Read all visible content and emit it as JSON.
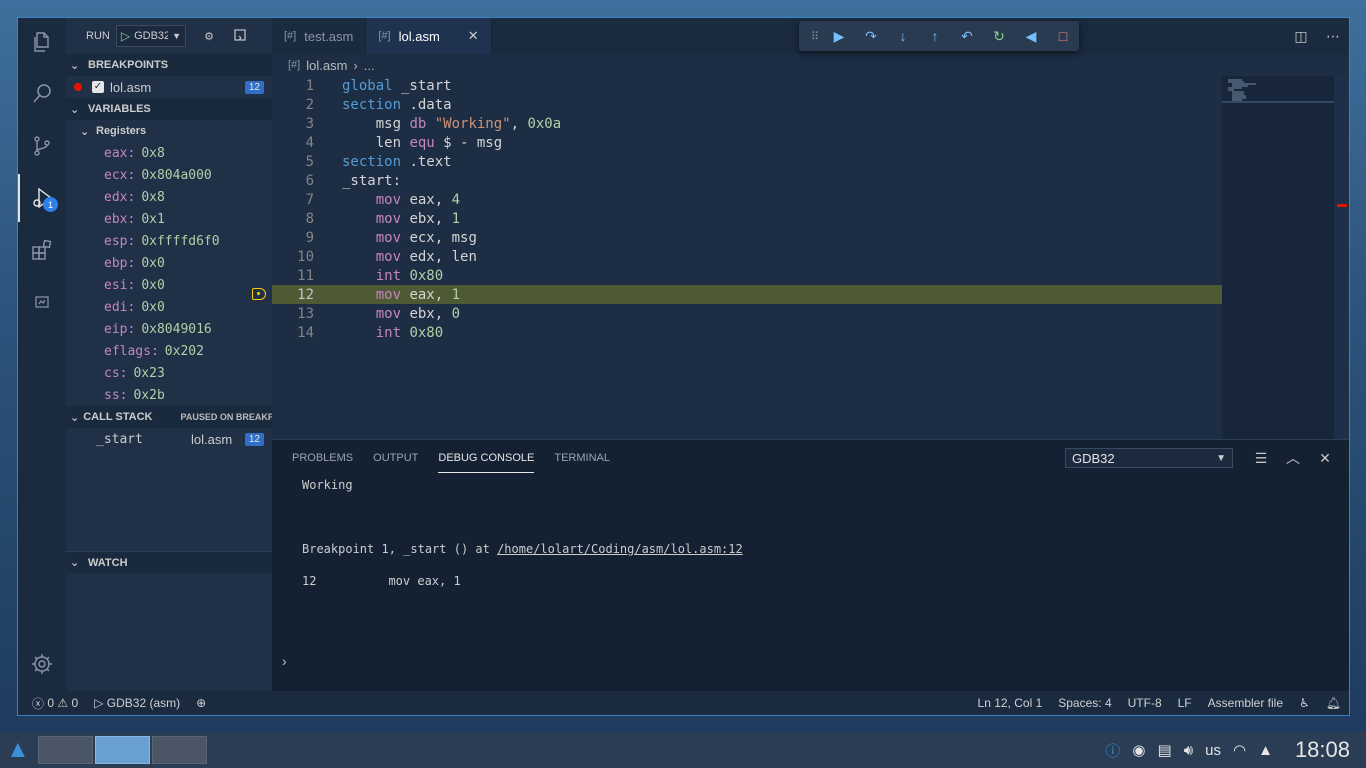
{
  "run_bar": {
    "label": "RUN",
    "config": "GDB32"
  },
  "breakpoints": {
    "title": "BREAKPOINTS",
    "items": [
      {
        "file": "lol.asm",
        "line": "12"
      }
    ]
  },
  "variables": {
    "title": "VARIABLES",
    "group": "Registers",
    "registers": [
      {
        "name": "eax:",
        "value": "0x8"
      },
      {
        "name": "ecx:",
        "value": "0x804a000"
      },
      {
        "name": "edx:",
        "value": "0x8"
      },
      {
        "name": "ebx:",
        "value": "0x1"
      },
      {
        "name": "esp:",
        "value": "0xffffd6f0"
      },
      {
        "name": "ebp:",
        "value": "0x0"
      },
      {
        "name": "esi:",
        "value": "0x0"
      },
      {
        "name": "edi:",
        "value": "0x0"
      },
      {
        "name": "eip:",
        "value": "0x8049016"
      },
      {
        "name": "eflags:",
        "value": "0x202"
      },
      {
        "name": "cs:",
        "value": "0x23"
      },
      {
        "name": "ss:",
        "value": "0x2b"
      }
    ]
  },
  "call_stack": {
    "title": "CALL STACK",
    "status": "PAUSED ON BREAKPOI",
    "frames": [
      {
        "name": "_start",
        "file": "lol.asm",
        "line": "12"
      }
    ]
  },
  "watch": {
    "title": "WATCH"
  },
  "tabs": [
    {
      "label": "test.asm",
      "active": false
    },
    {
      "label": "lol.asm",
      "active": true
    }
  ],
  "breadcrumb": {
    "file": "lol.asm",
    "rest": "..."
  },
  "code": {
    "lines": [
      {
        "n": "1"
      },
      {
        "n": "2"
      },
      {
        "n": "3"
      },
      {
        "n": "4"
      },
      {
        "n": "5"
      },
      {
        "n": "6"
      },
      {
        "n": "7"
      },
      {
        "n": "8"
      },
      {
        "n": "9"
      },
      {
        "n": "10"
      },
      {
        "n": "11"
      },
      {
        "n": "12"
      },
      {
        "n": "13"
      },
      {
        "n": "14"
      }
    ],
    "tokens": {
      "l1a": "global",
      "l1b": " _start",
      "l2a": "section",
      "l2b": " .data",
      "l3a": "    msg ",
      "l3b": "db",
      "l3c": " \"Working\"",
      "l3d": ", ",
      "l3e": "0x0a",
      "l4a": "    len ",
      "l4b": "equ",
      "l4c": " $ - msg",
      "l5a": "section",
      "l5b": " .text",
      "l6a": "_start:",
      "l7a": "    ",
      "l7b": "mov",
      "l7c": " eax, ",
      "l7d": "4",
      "l8a": "    ",
      "l8b": "mov",
      "l8c": " ebx, ",
      "l8d": "1",
      "l9a": "    ",
      "l9b": "mov",
      "l9c": " ecx, msg",
      "l10a": "    ",
      "l10b": "mov",
      "l10c": " edx, len",
      "l11a": "    ",
      "l11b": "int",
      "l11c": " ",
      "l11d": "0x80",
      "l12a": "    ",
      "l12b": "mov",
      "l12c": " eax, ",
      "l12d": "1",
      "l13a": "    ",
      "l13b": "mov",
      "l13c": " ebx, ",
      "l13d": "0",
      "l14a": "    ",
      "l14b": "int",
      "l14c": " ",
      "l14d": "0x80"
    }
  },
  "panel": {
    "tabs": [
      "PROBLEMS",
      "OUTPUT",
      "DEBUG CONSOLE",
      "TERMINAL"
    ],
    "active_tab": "DEBUG CONSOLE",
    "dropdown": "GDB32",
    "console": {
      "line1": "Working",
      "bp_prefix": "Breakpoint 1, _start () at ",
      "bp_link": "/home/lolart/Coding/asm/lol.asm:12",
      "src_line_no": "12",
      "src_line_text": "mov eax, 1"
    }
  },
  "statusbar": {
    "errors": "0",
    "warnings": "0",
    "debug_config": "GDB32 (asm)",
    "position": "Ln 12, Col 1",
    "spaces": "Spaces: 4",
    "encoding": "UTF-8",
    "eol": "LF",
    "language": "Assembler file"
  },
  "taskbar": {
    "keyboard": "us",
    "clock": "18:08"
  },
  "activity_badge": "1",
  "colors": {
    "accent": "#2f80ed",
    "breakpoint": "#e51400",
    "current_line": "#4d5a34"
  }
}
